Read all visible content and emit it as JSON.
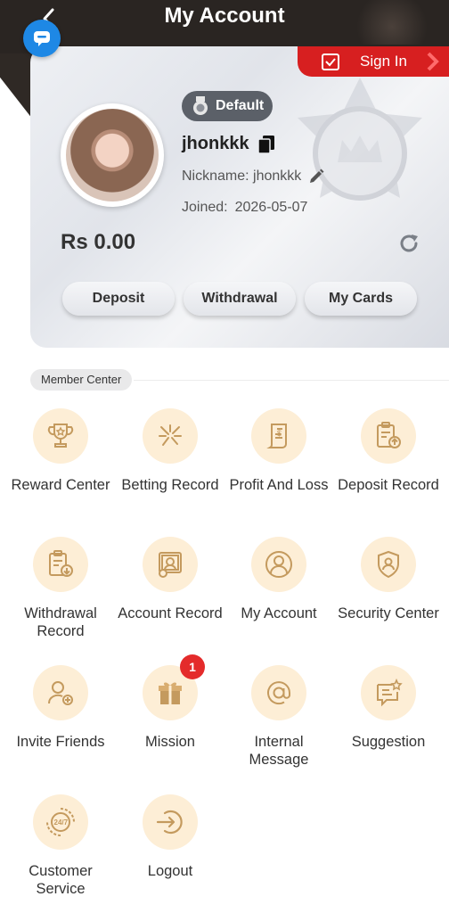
{
  "header": {
    "title": "My Account"
  },
  "signin": {
    "label": "Sign In"
  },
  "profile": {
    "level_badge": "Default",
    "username": "jhonkkk",
    "nickname": "Nickname: jhonkkk",
    "joined_label": "Joined:",
    "joined_date": "2026-05-07",
    "balance": "Rs 0.00"
  },
  "actions": {
    "deposit": "Deposit",
    "withdrawal": "Withdrawal",
    "my_cards": "My Cards"
  },
  "member_center": {
    "label": "Member Center",
    "items": [
      {
        "label": "Reward Center",
        "icon": "trophy-icon"
      },
      {
        "label": "Betting Record",
        "icon": "betting-icon"
      },
      {
        "label": "Profit And Loss",
        "icon": "profit-loss-icon"
      },
      {
        "label": "Deposit Record",
        "icon": "deposit-record-icon"
      },
      {
        "label": "Withdrawal Record",
        "icon": "withdrawal-record-icon"
      },
      {
        "label": "Account Record",
        "icon": "account-record-icon"
      },
      {
        "label": "My Account",
        "icon": "user-icon"
      },
      {
        "label": "Security Center",
        "icon": "shield-icon"
      },
      {
        "label": "Invite Friends",
        "icon": "invite-icon"
      },
      {
        "label": "Mission",
        "icon": "gift-icon",
        "badge": "1"
      },
      {
        "label": "Internal Message",
        "icon": "at-icon"
      },
      {
        "label": "Suggestion",
        "icon": "suggestion-icon"
      },
      {
        "label": "Customer Service",
        "icon": "support-24-7-icon"
      },
      {
        "label": "Logout",
        "icon": "logout-icon"
      }
    ]
  },
  "colors": {
    "accent_red": "#d71f20",
    "icon_bg": "#fdeed6",
    "icon_stroke": "#c9a06a",
    "chat_blue": "#1e88e5"
  }
}
